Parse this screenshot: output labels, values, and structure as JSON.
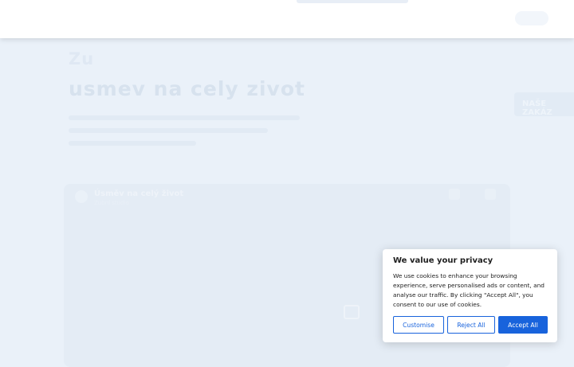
{
  "hero": {
    "kicker": "Zu",
    "title": "usmev na cely zivot",
    "side_button_label": "NAŠE ZAKÁZ"
  },
  "video": {
    "channel_title": "Úsměv na celý život",
    "channel_sub": "Zubní studio"
  },
  "cookie_banner": {
    "title": "We value your privacy",
    "text": "We use cookies to enhance your browsing experience, serve personalised ads or content, and analyse our traffic. By clicking \"Accept All\", you consent to our use of cookies.",
    "customise_label": "Customise",
    "reject_label": "Reject All",
    "accept_label": "Accept All",
    "accent_color": "#1863dc"
  },
  "icons": {
    "play": "play-icon",
    "avatar": "avatar"
  }
}
